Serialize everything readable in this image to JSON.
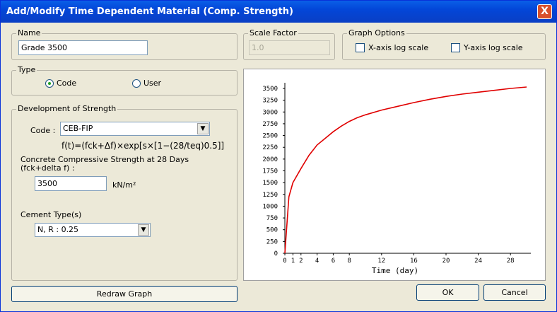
{
  "window": {
    "title": "Add/Modify Time Dependent Material (Comp. Strength)",
    "close_label": "X"
  },
  "name_group": {
    "title": "Name",
    "value": "Grade 3500"
  },
  "scale_group": {
    "title": "Scale Factor",
    "value": "1.0"
  },
  "graph_options": {
    "title": "Graph Options",
    "x_log_label": "X-axis log scale",
    "y_log_label": "Y-axis log scale"
  },
  "type_group": {
    "title": "Type",
    "code_label": "Code",
    "user_label": "User",
    "selected": "Code"
  },
  "strength_group": {
    "title": "Development of Strength",
    "code_label": "Code :",
    "code_value": "CEB-FIP",
    "formula": "f(t)=(fck+Δf)×exp[s×[1−(28/teq)0.5]]",
    "concrete_label_line1": "Concrete Compressive Strength at 28 Days",
    "concrete_label_line2": "(fck+delta f) :",
    "strength_value": "3500",
    "unit": "kN/m²",
    "cement_label": "Cement Type(s)",
    "cement_value": "N, R : 0.25"
  },
  "buttons": {
    "redraw": "Redraw Graph",
    "ok": "OK",
    "cancel": "Cancel"
  },
  "chart_data": {
    "type": "line",
    "title": "",
    "xlabel": "Time (day)",
    "ylabel": "",
    "xlim": [
      0,
      30
    ],
    "ylim": [
      0,
      3500
    ],
    "x_ticks": [
      0,
      1,
      2,
      4,
      6,
      8,
      12,
      16,
      20,
      24,
      28
    ],
    "y_ticks": [
      0,
      250,
      500,
      750,
      1000,
      1250,
      1500,
      1750,
      2000,
      2250,
      2500,
      2750,
      3000,
      3250,
      3500
    ],
    "grid": false,
    "series": [
      {
        "color": "#e00000",
        "x": [
          0,
          0.5,
          1,
          2,
          3,
          4,
          5,
          6,
          7,
          8,
          9,
          10,
          12,
          14,
          16,
          18,
          20,
          22,
          24,
          26,
          28,
          30
        ],
        "y": [
          0,
          1200,
          1500,
          1800,
          2080,
          2300,
          2440,
          2580,
          2700,
          2800,
          2880,
          2940,
          3040,
          3120,
          3200,
          3270,
          3330,
          3380,
          3420,
          3460,
          3500,
          3530
        ]
      }
    ]
  }
}
